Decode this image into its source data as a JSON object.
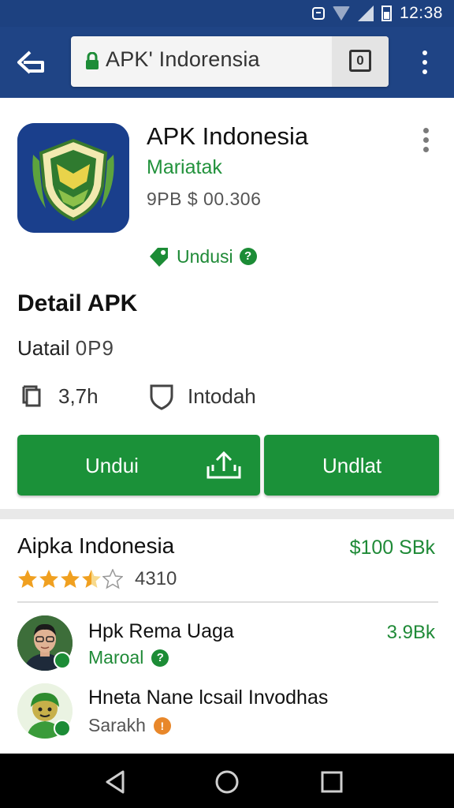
{
  "status_bar": {
    "time": "12:38",
    "icons": [
      "message-icon",
      "wifi-icon",
      "signal-icon",
      "battery-icon"
    ]
  },
  "browser": {
    "url_text": "APK' Indorensia",
    "icons": [
      "back-icon",
      "lock-icon",
      "tabs-icon",
      "overflow-menu-icon"
    ]
  },
  "app": {
    "title": "APK Indonesia",
    "subtitle": "Mariatak",
    "meta": "9PB $ 00.306",
    "download_label": "Undusi",
    "icon": "shield-logo-icon"
  },
  "detail": {
    "heading": "Detail APK",
    "line_label": "Uatail",
    "line_version": "0P9",
    "stat_downloads": "3,7h",
    "stat_security": "Intodah"
  },
  "buttons": {
    "primary": "Undui",
    "secondary": "Undlat"
  },
  "listing": {
    "title": "Aipka Indonesia",
    "price": "$100 SBk",
    "rating": 3.5,
    "rating_count": "4310"
  },
  "list_items": [
    {
      "title": "Hpk Rema Uaga",
      "subtitle": "Maroal",
      "price": "3.9Bk"
    },
    {
      "title": "Hneta Nane lcsail Invodhas",
      "subtitle": "Sarakh",
      "price": ""
    }
  ],
  "nav": {
    "icons": [
      "nav-back-icon",
      "nav-home-icon",
      "nav-recents-icon"
    ]
  },
  "colors": {
    "app_bar": "#1f4485",
    "accent_green": "#1b9139",
    "price_green": "#1f8a37",
    "star_orange": "#f0a020"
  }
}
